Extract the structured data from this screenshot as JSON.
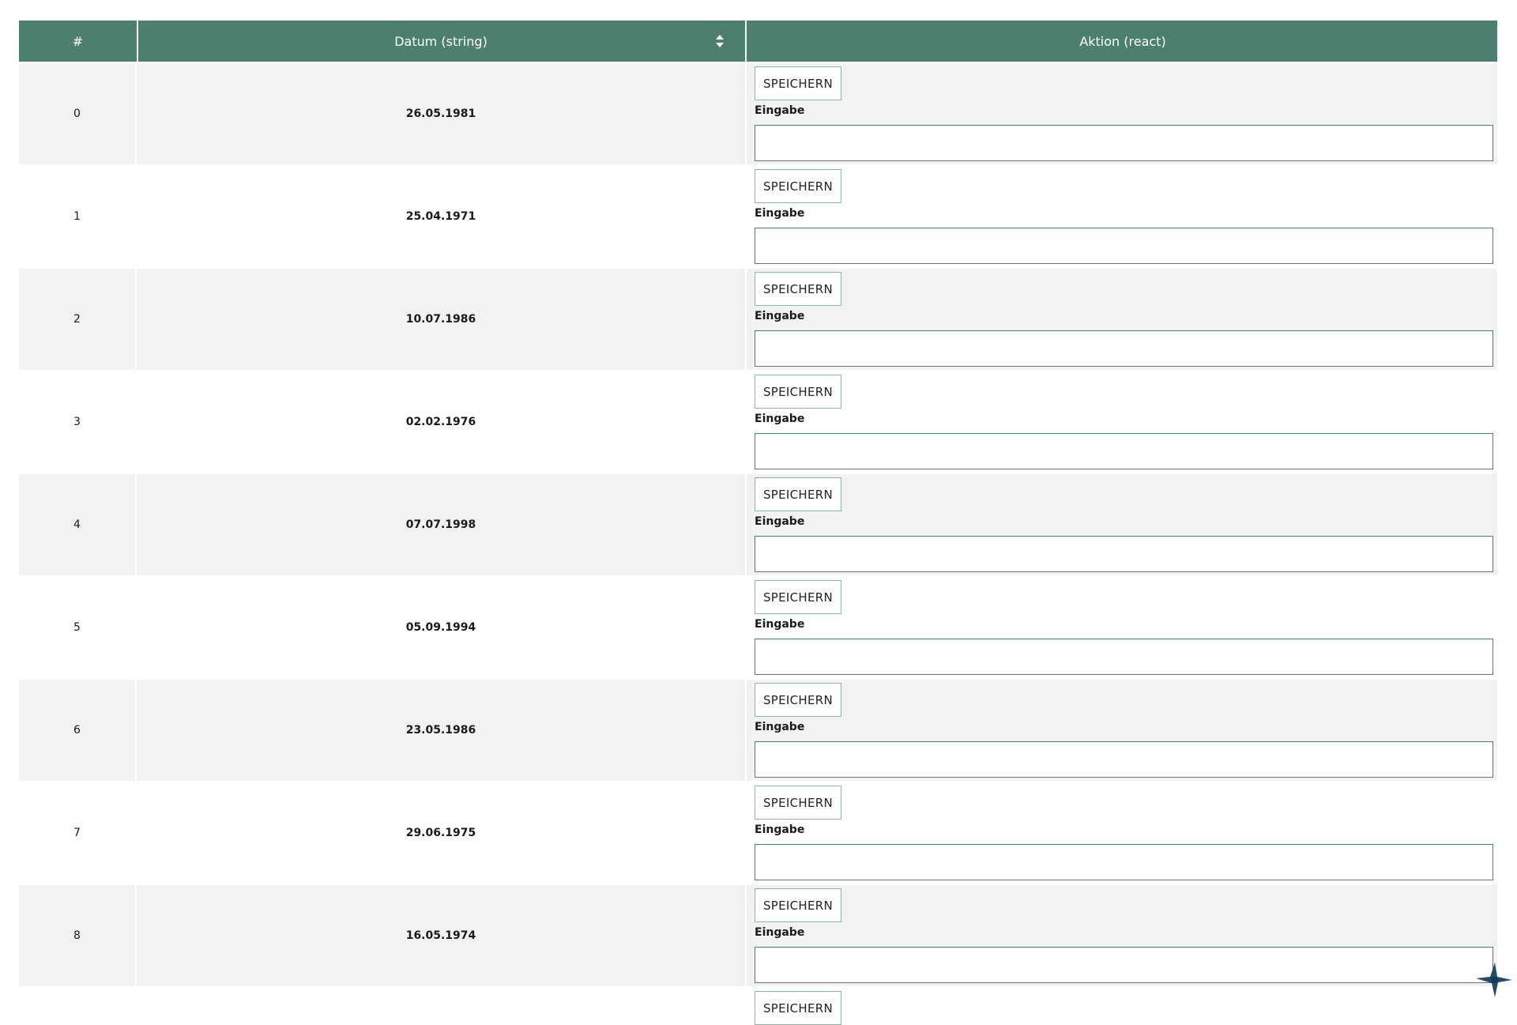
{
  "header": {
    "col_index": "#",
    "col_date": "Datum (string)",
    "col_action": "Aktion (react)",
    "sort_icon": "sort-up-down-icon"
  },
  "rows": [
    {
      "index": "0",
      "date": "26.05.1981",
      "button": "SPEICHERN",
      "label": "Eingabe",
      "value": ""
    },
    {
      "index": "1",
      "date": "25.04.1971",
      "button": "SPEICHERN",
      "label": "Eingabe",
      "value": ""
    },
    {
      "index": "2",
      "date": "10.07.1986",
      "button": "SPEICHERN",
      "label": "Eingabe",
      "value": ""
    },
    {
      "index": "3",
      "date": "02.02.1976",
      "button": "SPEICHERN",
      "label": "Eingabe",
      "value": ""
    },
    {
      "index": "4",
      "date": "07.07.1998",
      "button": "SPEICHERN",
      "label": "Eingabe",
      "value": ""
    },
    {
      "index": "5",
      "date": "05.09.1994",
      "button": "SPEICHERN",
      "label": "Eingabe",
      "value": ""
    },
    {
      "index": "6",
      "date": "23.05.1986",
      "button": "SPEICHERN",
      "label": "Eingabe",
      "value": ""
    },
    {
      "index": "7",
      "date": "29.06.1975",
      "button": "SPEICHERN",
      "label": "Eingabe",
      "value": ""
    },
    {
      "index": "8",
      "date": "16.05.1974",
      "button": "SPEICHERN",
      "label": "Eingabe",
      "value": ""
    }
  ],
  "partial_row": {
    "button": "SPEICHERN"
  },
  "colors": {
    "header_bg": "#4d7f6e",
    "row_shade": "#f2f2f2",
    "logo": "#1f4e6b"
  },
  "logo_icon": "bird-logo-icon"
}
